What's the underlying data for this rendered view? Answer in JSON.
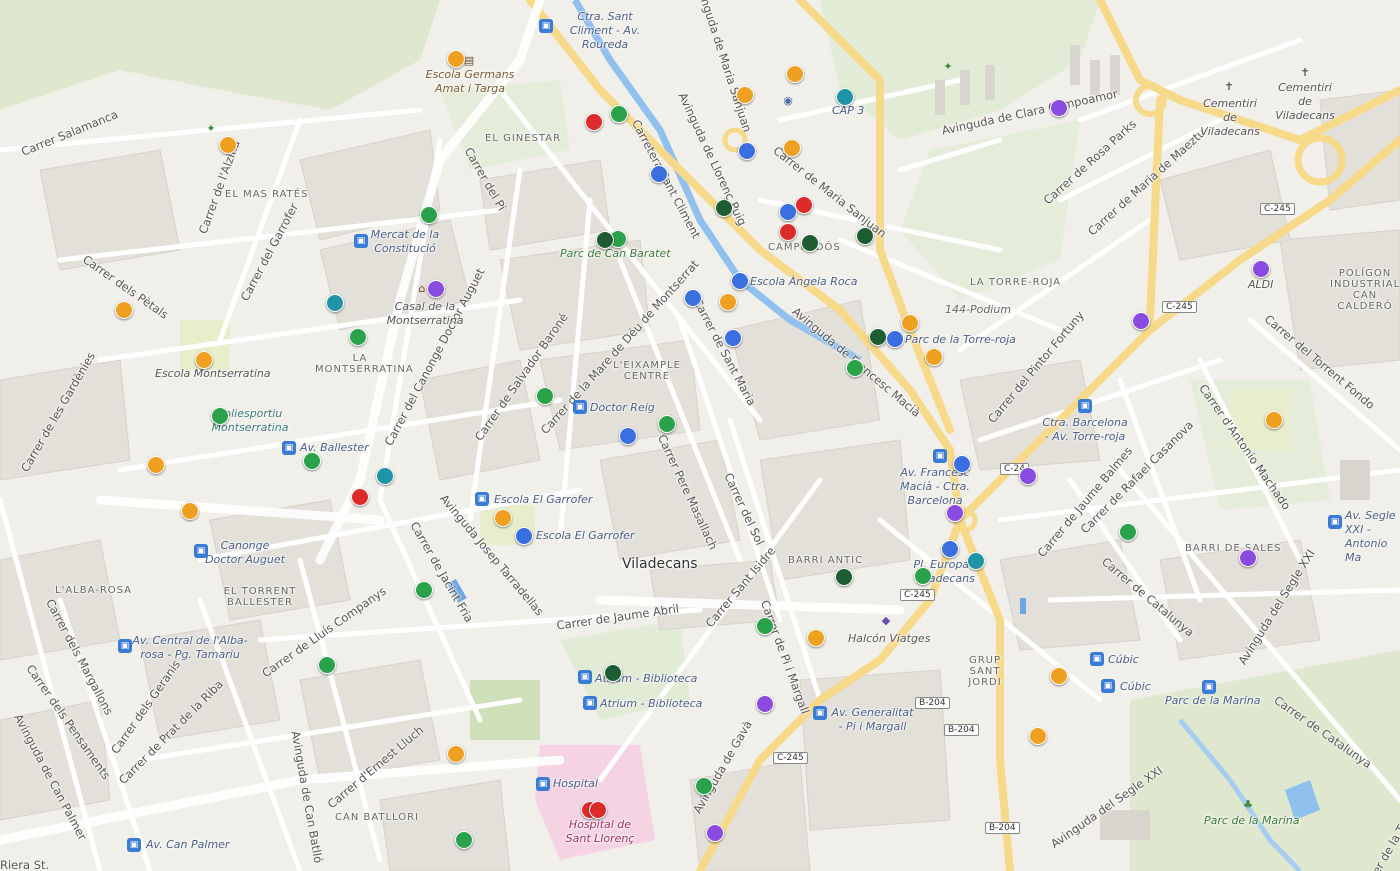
{
  "map": {
    "city": "Viladecans",
    "colors": {
      "orange": "#f0a020",
      "green": "#2aa24a",
      "darkgreen": "#1e5c32",
      "blue": "#3b6fe0",
      "red": "#dd2b2b",
      "purple": "#8a4be0",
      "teal": "#1f93a8"
    },
    "streets": [
      "Carrer Salamanca",
      "Carrer de l'Alzina",
      "Carrer del Garrofer",
      "Carrer dels Pètals",
      "Carrer de les Gardènies",
      "Carrer del Pi",
      "Carrer del Canonge Doctor Auguet",
      "Carrer de Salvador Baroné",
      "Carrer de la Mare de Déu de Montserrat",
      "Carretera Sant Climent",
      "Avinguda de Llorenç Puig",
      "Avinguda de Maria Sanjuan",
      "Carrer de Maria Sanjuan",
      "Carrer de Sant Maria",
      "Avinguda de Francesc Macià",
      "Carrer Pere Masallach",
      "Carrer del Sol",
      "Carrer Sant Isidre",
      "Carrer de Pi i Margall",
      "Carrer de Jaume Abril",
      "Avinguda Josep Tarradellas",
      "Carrer de Lluís Companys",
      "Carrer de Jacint Fria",
      "Carrer dels Geranis",
      "Carrer de Prat de la Riba",
      "Carrer d'Ernest Lluch",
      "Avinguda de Can Batlló",
      "Avinguda de Gavà",
      "Avinguda de Can Palmer",
      "Carrer dels Margallons",
      "Carrer dels Pensaments",
      "Avinguda de Clara Campoamor",
      "Carrer de Rosa Parks",
      "Carrer de Maria de Maeztu",
      "Carrer del Pintor Fortuny",
      "Carrer de Jaume Balmes",
      "Carrer de Rafael Casanova",
      "Carrer d'Antonio Machado",
      "Carrer del Torrent Fondo",
      "Carrer de Catalunya",
      "Avinguda del Segle XXI",
      "Carrer de la Tecnologia",
      "Riera St."
    ],
    "districts": [
      "EL GINESTAR",
      "EL MAS RATÉS",
      "LA MONTSERRATINA",
      "L'EIXAMPLE CENTRE",
      "BARRI ANTIC",
      "L'ALBA-ROSA",
      "EL TORRENT BALLESTER",
      "CAN BATLLORI",
      "CAMPREDÓS",
      "LA TORRE-ROJA",
      "BARRI DE SALES",
      "GRUP SANT JORDI",
      "POLÍGON INDUSTRIAL CAN CALDERÓ"
    ],
    "pois": [
      "Ctra. Sant Climent - Av. Roureda",
      "Escola Germans Amat i Targa",
      "CAP 3",
      "Cementiri de Viladecans",
      "Mercat de la Constitució",
      "Parc de Can Baratet",
      "Casal de la Montserratina",
      "Escola Montserratina",
      "Poliesportiu Montserratina",
      "Av. Ballester",
      "Doctor Reig",
      "Escola Àngela Roca",
      "144-Podium",
      "Parc de la Torre-roja",
      "ALDI",
      "Ctra. Barcelona - Av. Torre-roja",
      "Av. Francesc Macià - Ctra. Barcelona",
      "Escola El Garrofer",
      "Canonge Doctor Auguet",
      "Av. Central de l'Alba-rosa - Pg. Tamariu",
      "Atrium - Biblioteca",
      "Halcón Viatges",
      "Av. Generalitat - Pi i Margall",
      "Pl. Europa - Viladecans",
      "Cúbic",
      "Parc de la Marina",
      "Hospital",
      "Hospital de Sant Llorenç",
      "Av. Can Palmer",
      "Av. Segle XXI - Antonio Ma"
    ],
    "roads": [
      "C-245",
      "C-245",
      "C-245",
      "C-245",
      "B-204",
      "B-204",
      "B-204",
      "C-24"
    ]
  }
}
